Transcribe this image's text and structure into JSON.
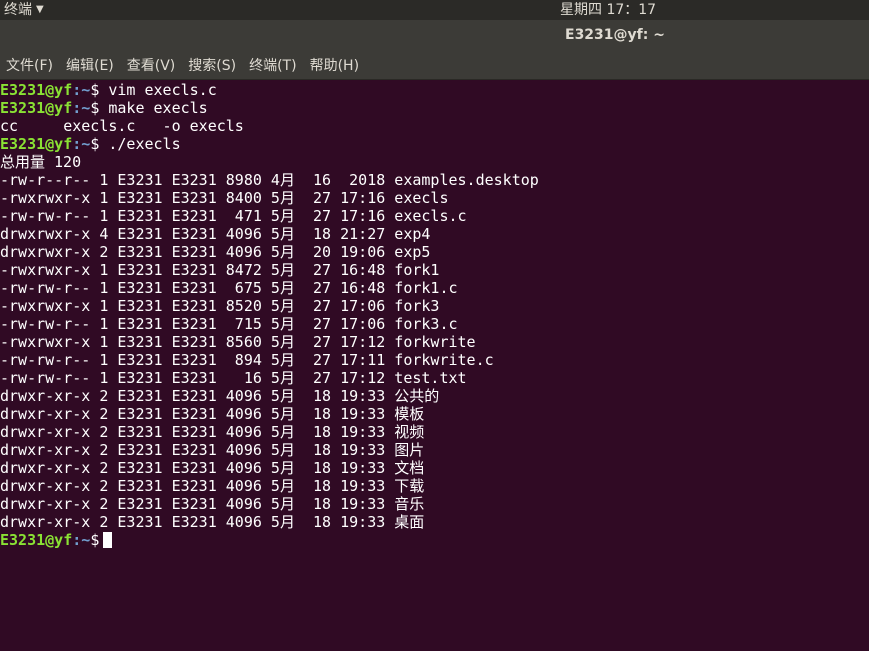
{
  "topbar": {
    "app_name": "终端",
    "clock": "星期四 17：17"
  },
  "window": {
    "title": "E3231@yf: ~"
  },
  "menu": [
    "文件(F)",
    "编辑(E)",
    "查看(V)",
    "搜索(S)",
    "终端(T)",
    "帮助(H)"
  ],
  "prompt": {
    "user": "E3231@yf",
    "path": ":~",
    "symbol": "$"
  },
  "commands": {
    "c1": " vim execls.c",
    "c2": " make execls",
    "c3": " ./execls"
  },
  "make_output": "cc     execls.c   -o execls",
  "total_line": "总用量 120",
  "listing": [
    "-rw-r--r-- 1 E3231 E3231 8980 4月  16  2018 examples.desktop",
    "-rwxrwxr-x 1 E3231 E3231 8400 5月  27 17:16 execls",
    "-rw-rw-r-- 1 E3231 E3231  471 5月  27 17:16 execls.c",
    "drwxrwxr-x 4 E3231 E3231 4096 5月  18 21:27 exp4",
    "drwxrwxr-x 2 E3231 E3231 4096 5月  20 19:06 exp5",
    "-rwxrwxr-x 1 E3231 E3231 8472 5月  27 16:48 fork1",
    "-rw-rw-r-- 1 E3231 E3231  675 5月  27 16:48 fork1.c",
    "-rwxrwxr-x 1 E3231 E3231 8520 5月  27 17:06 fork3",
    "-rw-rw-r-- 1 E3231 E3231  715 5月  27 17:06 fork3.c",
    "-rwxrwxr-x 1 E3231 E3231 8560 5月  27 17:12 forkwrite",
    "-rw-rw-r-- 1 E3231 E3231  894 5月  27 17:11 forkwrite.c",
    "-rw-rw-r-- 1 E3231 E3231   16 5月  27 17:12 test.txt",
    "drwxr-xr-x 2 E3231 E3231 4096 5月  18 19:33 公共的",
    "drwxr-xr-x 2 E3231 E3231 4096 5月  18 19:33 模板",
    "drwxr-xr-x 2 E3231 E3231 4096 5月  18 19:33 视频",
    "drwxr-xr-x 2 E3231 E3231 4096 5月  18 19:33 图片",
    "drwxr-xr-x 2 E3231 E3231 4096 5月  18 19:33 文档",
    "drwxr-xr-x 2 E3231 E3231 4096 5月  18 19:33 下载",
    "drwxr-xr-x 2 E3231 E3231 4096 5月  18 19:33 音乐",
    "drwxr-xr-x 2 E3231 E3231 4096 5月  18 19:33 桌面"
  ],
  "colors": {
    "terminal_bg": "#300a24",
    "prompt_user": "#8ae234",
    "prompt_path": "#729fcf",
    "text": "#ffffff"
  }
}
